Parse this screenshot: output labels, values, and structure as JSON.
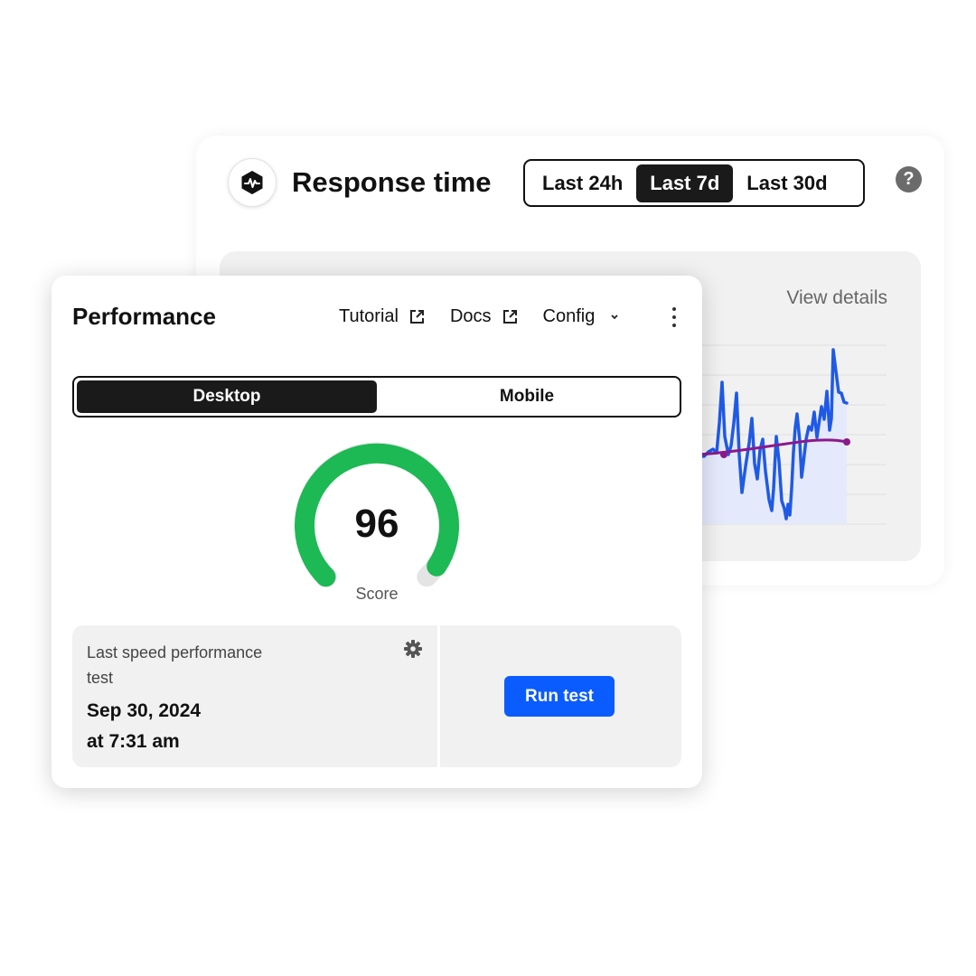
{
  "response_time": {
    "title": "Response time",
    "logo_icon": "heartbeat-hexagon-icon",
    "ranges": [
      {
        "label": "Last 24h",
        "active": false
      },
      {
        "label": "Last 7d",
        "active": true
      },
      {
        "label": "Last 30d",
        "active": false
      }
    ],
    "help_glyph": "?",
    "view_details": "View details"
  },
  "performance": {
    "title": "Performance",
    "links": [
      {
        "label": "Tutorial",
        "icon": "external-link-icon"
      },
      {
        "label": "Docs",
        "icon": "external-link-icon"
      },
      {
        "label": "Config",
        "icon": "chevron-down-icon"
      }
    ],
    "devices": [
      {
        "label": "Desktop",
        "active": true
      },
      {
        "label": "Mobile",
        "active": false
      }
    ],
    "score": {
      "value": "96",
      "label": "Score",
      "max": 100,
      "color": "#1db954"
    },
    "last_test": {
      "label": "Last speed performance test",
      "date": "Sep 30, 2024",
      "time": "at 7:31 am"
    },
    "run_button": "Run test"
  },
  "colors": {
    "accent_blue": "#0a5cff",
    "score_green": "#1db954",
    "series_blue": "#1f5ae6",
    "trend_purple": "#8b1a8b"
  }
}
